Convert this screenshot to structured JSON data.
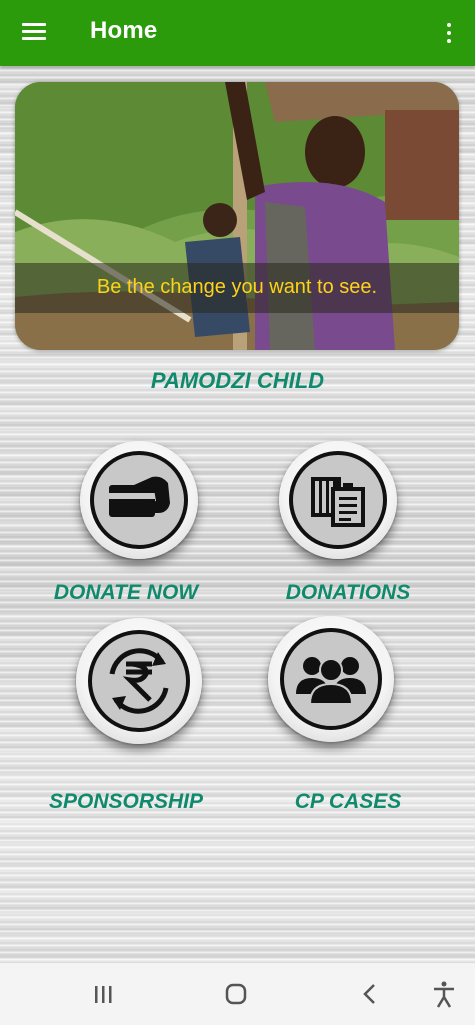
{
  "appbar": {
    "title": "Home",
    "menu_icon": "hamburger-menu-icon",
    "overflow_icon": "more-vert-icon",
    "color": "#2b9b0c"
  },
  "banner": {
    "caption": "Be the change you want to see.",
    "caption_color": "#ffd21a"
  },
  "org_name": "PAMODZI CHILD",
  "accent_color": "#0f8a6c",
  "tiles": [
    {
      "label": "DONATE NOW",
      "icon": "card-payment-icon"
    },
    {
      "label": "DONATIONS",
      "icon": "documents-icon"
    },
    {
      "label": "SPONSORSHIP",
      "icon": "rupee-exchange-icon"
    },
    {
      "label": "CP CASES",
      "icon": "group-people-icon"
    }
  ],
  "navbar": {
    "buttons": [
      "recent-apps-icon",
      "home-icon",
      "back-icon",
      "accessibility-icon"
    ]
  }
}
